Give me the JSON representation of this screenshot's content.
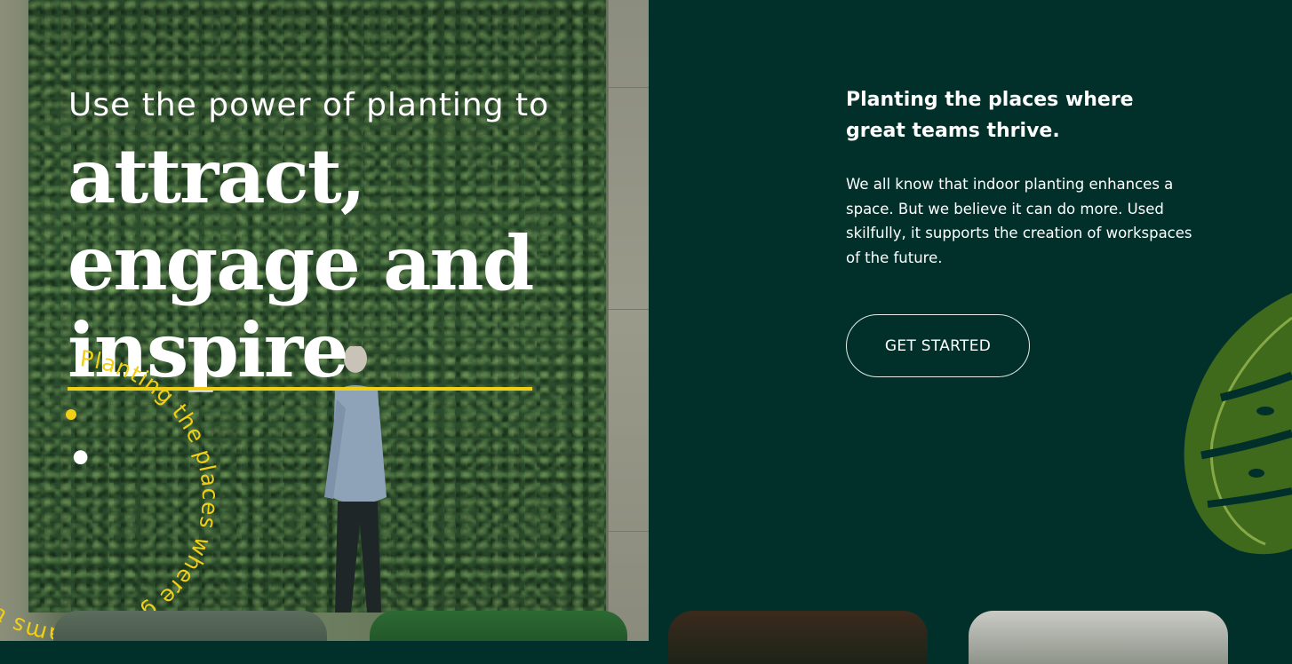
{
  "hero": {
    "eyebrow": "Use the power of planting to",
    "headline_line1": "attract,",
    "headline_line2": "engage and",
    "headline_word3": "inspire",
    "headline_punct": ".",
    "circular_text": "Planting the places where great teams thrive  •  Planting the places where great teams thrive  •  ",
    "accent_color": "#f1cf14",
    "image_icon": "green-wall-photo"
  },
  "intro": {
    "heading": "Planting the places where great teams thrive.",
    "body": "We all know that indoor planting enhances a space. But we believe it can do more. Used skilfully, it supports the creation of workspaces of the future.",
    "cta_label": "GET STARTED"
  },
  "colors": {
    "background": "#01302b",
    "text": "#ffffff",
    "accent": "#f1cf14"
  },
  "cards": [
    "plant-card-thumbnail",
    "plant-card-thumbnail",
    "plant-card-thumbnail",
    "plant-card-thumbnail"
  ]
}
